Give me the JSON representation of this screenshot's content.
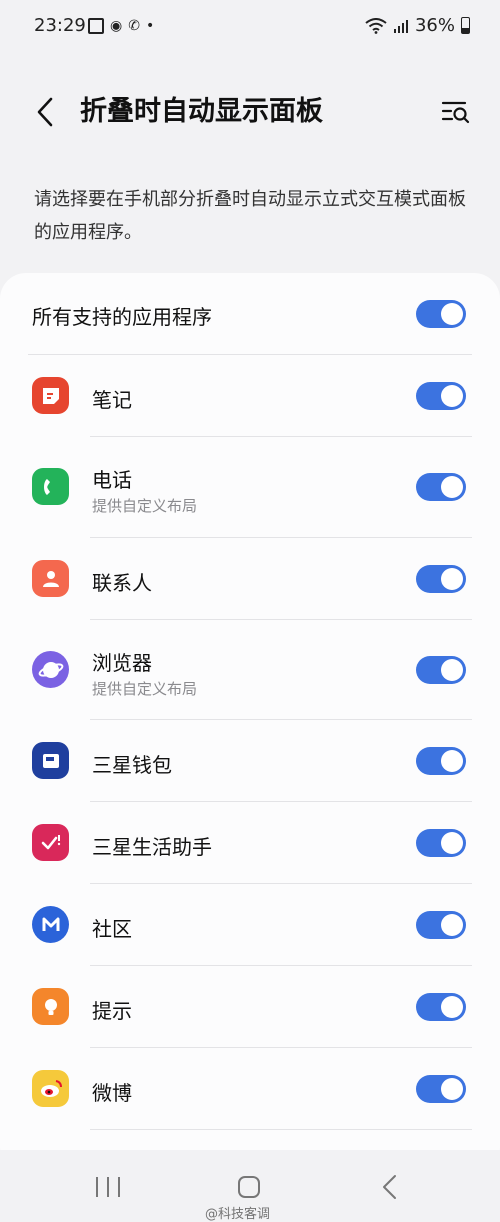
{
  "status_bar": {
    "time": "23:29",
    "battery": "36%"
  },
  "header": {
    "title": "折叠时自动显示面板"
  },
  "description": "请选择要在手机部分折叠时自动显示立式交互模式面板的应用程序。",
  "all_apps": {
    "label": "所有支持的应用程序",
    "enabled": true
  },
  "apps": [
    {
      "name": "笔记",
      "subtitle": "",
      "enabled": true,
      "icon": "notes-icon",
      "color": "#e6452f"
    },
    {
      "name": "电话",
      "subtitle": "提供自定义布局",
      "enabled": true,
      "icon": "phone-icon",
      "color": "#23b35a"
    },
    {
      "name": "联系人",
      "subtitle": "",
      "enabled": true,
      "icon": "contacts-icon",
      "color": "#f4684e"
    },
    {
      "name": "浏览器",
      "subtitle": "提供自定义布局",
      "enabled": true,
      "icon": "browser-icon",
      "color": "#7b62e3"
    },
    {
      "name": "三星钱包",
      "subtitle": "",
      "enabled": true,
      "icon": "wallet-icon",
      "color": "#1f3f9e"
    },
    {
      "name": "三星生活助手",
      "subtitle": "",
      "enabled": true,
      "icon": "life-assistant-icon",
      "color": "#d9285a"
    },
    {
      "name": "社区",
      "subtitle": "",
      "enabled": true,
      "icon": "community-icon",
      "color": "#2b63d9"
    },
    {
      "name": "提示",
      "subtitle": "",
      "enabled": true,
      "icon": "tips-icon",
      "color": "#f4862b"
    },
    {
      "name": "微博",
      "subtitle": "",
      "enabled": true,
      "icon": "weibo-icon",
      "color": "#f5c93b"
    }
  ],
  "watermark": "@科技客调"
}
